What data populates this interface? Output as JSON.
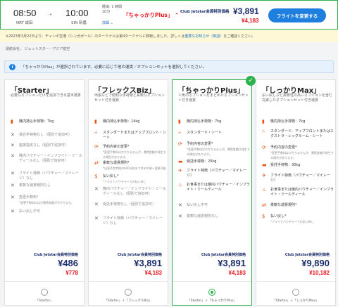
{
  "flight": {
    "dep_time": "08:50",
    "dep_code": "NRT 成田",
    "arr_time": "10:00",
    "arr_code": "SIN 新嘉",
    "conn_info": "経由: 1 時間 10分",
    "detail_link": "詳細 ⌄",
    "fare_name": "「ちゃっかりPlus」 ⌃",
    "club_label": "Club Jetstar会員特別価格",
    "club_price": "¥3,891",
    "normal_price": "¥4,183",
    "change_button": "フライトを変更する"
  },
  "notice": {
    "text": "※2023年3月22日より、チャンギ空港（シンガポール）のターミナルは第4ターミナルに移転しました。詳しくは",
    "link": "重要なお知らせ（英語）",
    "tail": "をご確認ください。"
  },
  "carrier": "運航会社： ジェットスター・アジア航空",
  "selected_message": "「ちゃっかりPlus」が選択されています。必要に応じて他の運賃／オプションセットを選択してください。",
  "cards": [
    {
      "title": "「Starter」",
      "desc": "必要なオプションだけを追加できる基本運賃",
      "features": [
        {
          "icon": "carry-on-bag-icon",
          "glyph": "▮",
          "text": "機内持込手荷物：7kg",
          "sub": "",
          "ok": true
        },
        {
          "icon": "x-icon",
          "glyph": "✕",
          "text": "受託手荷物なし（個別で追加可）",
          "sub": "",
          "ok": false
        },
        {
          "icon": "x-icon",
          "glyph": "✕",
          "text": "座席指定なし（個別で追加可）",
          "sub": "",
          "ok": false
        },
        {
          "icon": "x-icon",
          "glyph": "✕",
          "text": "機内バウチャー／インフライト・ミールディールなし（個別で追加可）",
          "sub": "",
          "ok": false
        },
        {
          "icon": "x-icon",
          "glyph": "✕",
          "text": "フライト特典（バウチャー／マイレージ）なし",
          "sub": "",
          "ok": false
        },
        {
          "icon": "x-icon",
          "glyph": "✕",
          "text": "柔軟な運賃規則なし",
          "sub": "",
          "ok": false
        },
        {
          "icon": "x-icon",
          "glyph": "✕",
          "text": "変更手数料*",
          "sub": "*変更手数料のほか運賃差額がかかります。",
          "ok": false
        },
        {
          "icon": "x-icon",
          "glyph": "✕",
          "text": "払い戻し不可",
          "sub": "",
          "ok": false
        }
      ],
      "club_label": "Club Jetstar会員特別価格",
      "price": "¥486",
      "normal": "¥778",
      "radio_label": "「Starter」",
      "selected": false
    },
    {
      "title": "「フレックスBiz」",
      "desc": "出張などで便利な手荷物と柔軟なオプションセット付き運賃",
      "features": [
        {
          "icon": "carry-on-bag-icon",
          "glyph": "▮",
          "text": "機内持込手荷物：14kg",
          "sub": "",
          "ok": true
        },
        {
          "icon": "seat-icon",
          "glyph": "⑃",
          "text": "スタンダードまたはアップフロント・シート",
          "sub": "",
          "ok": true
        },
        {
          "icon": "change-icon",
          "glyph": "⟳",
          "text": "予約内容の変更*",
          "sub": "*変更手数料はかかりませんが、運賃差額が発生する場合があります。",
          "ok": true
        },
        {
          "icon": "flex-icon",
          "glyph": "⇄",
          "text": "柔軟な運賃規則*",
          "sub": "*出発予定時刻の600分前まで早めの便へ変更可能",
          "ok": true
        },
        {
          "icon": "refund-icon",
          "glyph": "$",
          "text": "払い戻し*",
          "sub": "*フライトバウチャーでの払い戻し",
          "ok": true
        },
        {
          "icon": "x-icon",
          "glyph": "✕",
          "text": "機内バウチャー／インフライト・ミールディールなし（個別で追加可）",
          "sub": "",
          "ok": false
        },
        {
          "icon": "x-icon",
          "glyph": "✕",
          "text": "受託手荷物なし（個別で追加可）",
          "sub": "",
          "ok": false
        },
        {
          "icon": "x-icon",
          "glyph": "✕",
          "text": "フライト特典（バウチャー／マイレージ）なし",
          "sub": "",
          "ok": false
        }
      ],
      "club_label": "Club Jetstar会員特別価格",
      "price": "¥3,891",
      "normal": "¥4,183",
      "radio_label": "「Starter」＋「フレックスBiz」",
      "selected": false
    },
    {
      "title": "「ちゃっかりPlus」",
      "desc": "人気のオプションをまとめたオプションセット付き運賃",
      "features": [
        {
          "icon": "carry-on-bag-icon",
          "glyph": "▮",
          "text": "機内持込手荷物：7kg",
          "sub": "",
          "ok": true
        },
        {
          "icon": "seat-icon",
          "glyph": "⑃",
          "text": "スタンダード・シート",
          "sub": "",
          "ok": true
        },
        {
          "icon": "change-icon",
          "glyph": "⟳",
          "text": "予約内容の変更*",
          "sub": "*変更手数料はかかりませんが、運賃差額が発生する場合があります。",
          "ok": true
        },
        {
          "icon": "checked-bag-icon",
          "glyph": "▬",
          "text": "受託手荷物：20kg",
          "sub": "",
          "ok": true
        },
        {
          "icon": "plane-icon",
          "glyph": "✈",
          "text": "フライト特典（バウチャー／マイレージ）",
          "sub": "",
          "ok": true
        },
        {
          "icon": "meal-icon",
          "glyph": "♨",
          "text": "お食事または機内バウチャー／インフライト・ミールディール",
          "sub": "",
          "ok": true
        },
        {
          "icon": "x-icon",
          "glyph": "✕",
          "text": "払い戻し不可",
          "sub": "",
          "ok": false
        },
        {
          "icon": "x-icon",
          "glyph": "✕",
          "text": "柔軟な運賃規則なし",
          "sub": "",
          "ok": false
        }
      ],
      "club_label": "Club Jetstar会員特別価格",
      "price": "¥3,891",
      "normal": "¥4,183",
      "radio_label": "「Starter」＋「ちゃっかりPlus」",
      "selected": true
    },
    {
      "title": "「しっかりMax」",
      "desc": "払い戻しなど柔軟性の高いオプションを含む充実したオプションセット付き運賃",
      "features": [
        {
          "icon": "carry-on-bag-icon",
          "glyph": "▮",
          "text": "機内持込手荷物：7kg",
          "sub": "",
          "ok": true
        },
        {
          "icon": "seat-icon",
          "glyph": "⑃",
          "text": "スタンダード、アップフロントまたはエクストラ・レッグルーム・シート",
          "sub": "",
          "ok": true
        },
        {
          "icon": "change-icon",
          "glyph": "⟳",
          "text": "予約内容の変更*",
          "sub": "*変更手数料はかかりませんが、運賃差額が発生する場合があります。",
          "ok": true
        },
        {
          "icon": "checked-bag-icon",
          "glyph": "▬",
          "text": "受託手荷物：30kg",
          "sub": "",
          "ok": true
        },
        {
          "icon": "plane-icon",
          "glyph": "✈",
          "text": "フライト特典（バウチャー／マイレージ）",
          "sub": "",
          "ok": true
        },
        {
          "icon": "meal-icon",
          "glyph": "♨",
          "text": "お食事または機内バウチャー／インフライト・ミールディール",
          "sub": "",
          "ok": true
        },
        {
          "icon": "flex-icon",
          "glyph": "⇄",
          "text": "柔軟な運賃規則*",
          "sub": "",
          "ok": true
        },
        {
          "icon": "refund-icon",
          "glyph": "$",
          "text": "払い戻し*",
          "sub": "*フライトバウチャーでの払い戻し",
          "ok": true
        }
      ],
      "club_label": "Club Jetstar会員特別価格",
      "price": "¥9,890",
      "normal": "¥10,182",
      "radio_label": "「Starter」＋「しっかりMax」",
      "selected": false
    }
  ]
}
